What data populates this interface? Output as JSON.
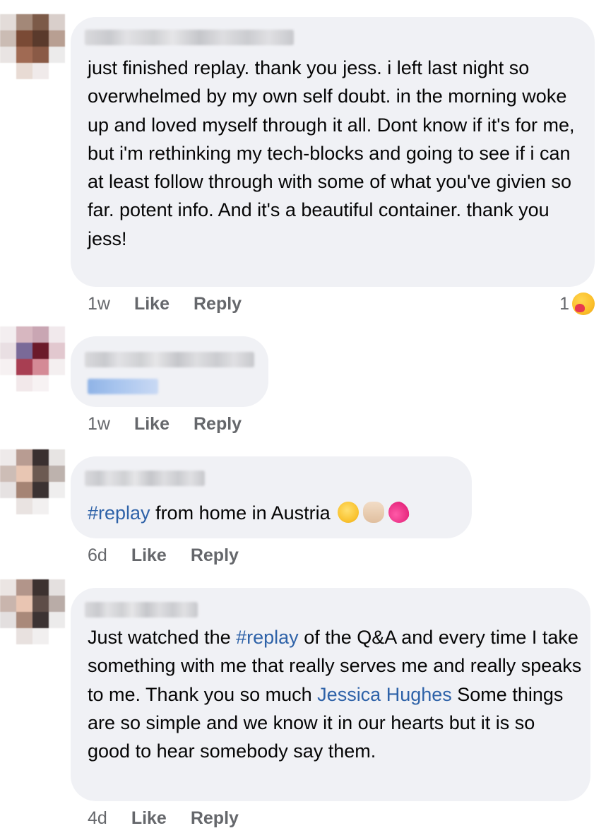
{
  "comments": [
    {
      "text": "just finished replay.  thank you jess. i left last night so overwhelmed by my own self doubt.  in the morning woke up and loved myself through it all. Dont know if it's for me, but i'm rethinking my tech-blocks and going to see if i can at least follow through with some of what you've givien so far. potent info. And it's a beautiful container. thank you jess!",
      "time": "1w",
      "like": "Like",
      "reply": "Reply",
      "reaction_count": "1",
      "reaction_icon": "hugging-heart-face-icon"
    },
    {
      "time": "1w",
      "like": "Like",
      "reply": "Reply"
    },
    {
      "hashtag": "#replay",
      "text": " from home in Austria",
      "emojis": [
        "star-struck-face-icon",
        "victory-hand-icon",
        "two-hearts-icon"
      ],
      "time": "6d",
      "like": "Like",
      "reply": "Reply"
    },
    {
      "text_1": "Just watched the ",
      "hashtag": "#replay",
      "text_2": " of the Q&A and every time I take something with me that really serves me and really speaks to me. Thank you so much ",
      "mention": "Jessica Hughes",
      "text_3": " Some things are so simple and we know it in our hearts but it is so good to hear somebody say them.",
      "time": "4d",
      "like": "Like",
      "reply": "Reply"
    }
  ],
  "colors": {
    "bubble": "#f0f1f5",
    "link": "#2e62a8",
    "meta": "#65676b"
  }
}
